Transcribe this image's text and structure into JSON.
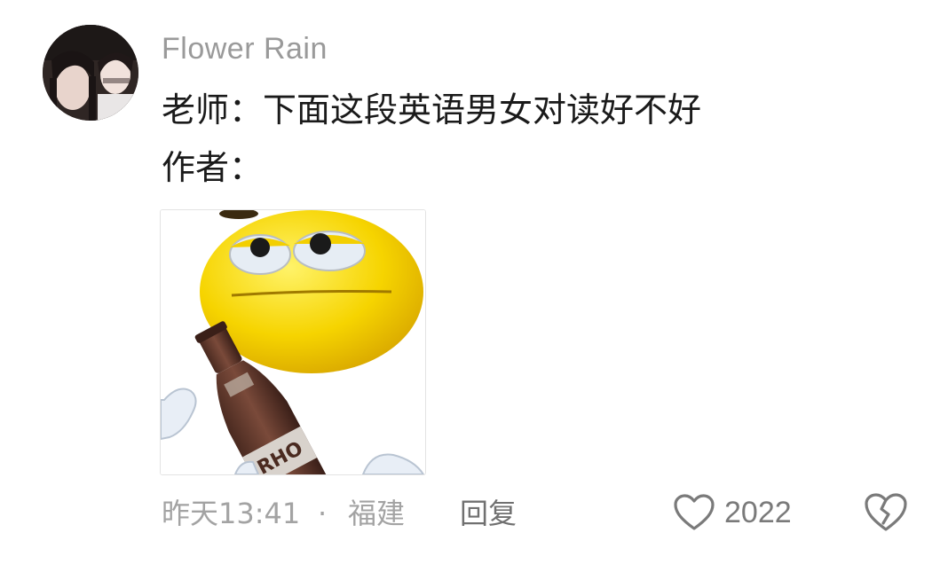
{
  "comment": {
    "username": "Flower Rain",
    "lines": [
      "老师：下面这段英语男女对读好不好",
      "作者："
    ],
    "timestamp": "昨天13:41",
    "separator": "·",
    "location": "福建",
    "reply_label": "回复",
    "like_count": "2022",
    "sticker": {
      "description_icon": "yellow-smiley-with-beer-bottle",
      "bottle_label": "RHO"
    },
    "icons": {
      "like": "heart-outline-icon",
      "dislike": "broken-heart-icon"
    },
    "colors": {
      "username": "#9a9a9a",
      "text": "#1a1a1a",
      "meta": "#a3a3a3",
      "smiley": "#f4d000"
    }
  }
}
